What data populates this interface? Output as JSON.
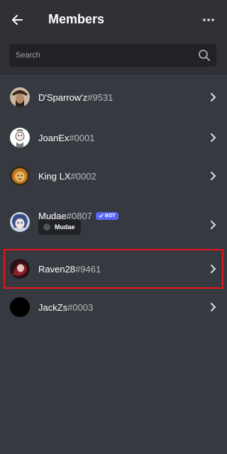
{
  "header": {
    "title": "Members",
    "back_icon": "arrow-left-icon",
    "more_icon": "more-horizontal-icon"
  },
  "search": {
    "placeholder": "Search",
    "icon": "search-icon"
  },
  "members": [
    {
      "name": "D'Sparrow'z",
      "discriminator": "#9531"
    },
    {
      "name": "JoanEx",
      "discriminator": "#0001"
    },
    {
      "name": "King LX",
      "discriminator": "#0002"
    },
    {
      "name": "Mudae",
      "discriminator": "#0807",
      "badge": "BOT",
      "role": "Mudae"
    },
    {
      "name": "Raven28",
      "discriminator": "#9461",
      "highlighted": true
    },
    {
      "name": "JackZs",
      "discriminator": "#0003"
    }
  ],
  "colors": {
    "background": "#36393f",
    "header": "#2f3136",
    "search_bg": "#202225",
    "bot_badge": "#5865f2",
    "highlight_border": "#e8141b"
  }
}
